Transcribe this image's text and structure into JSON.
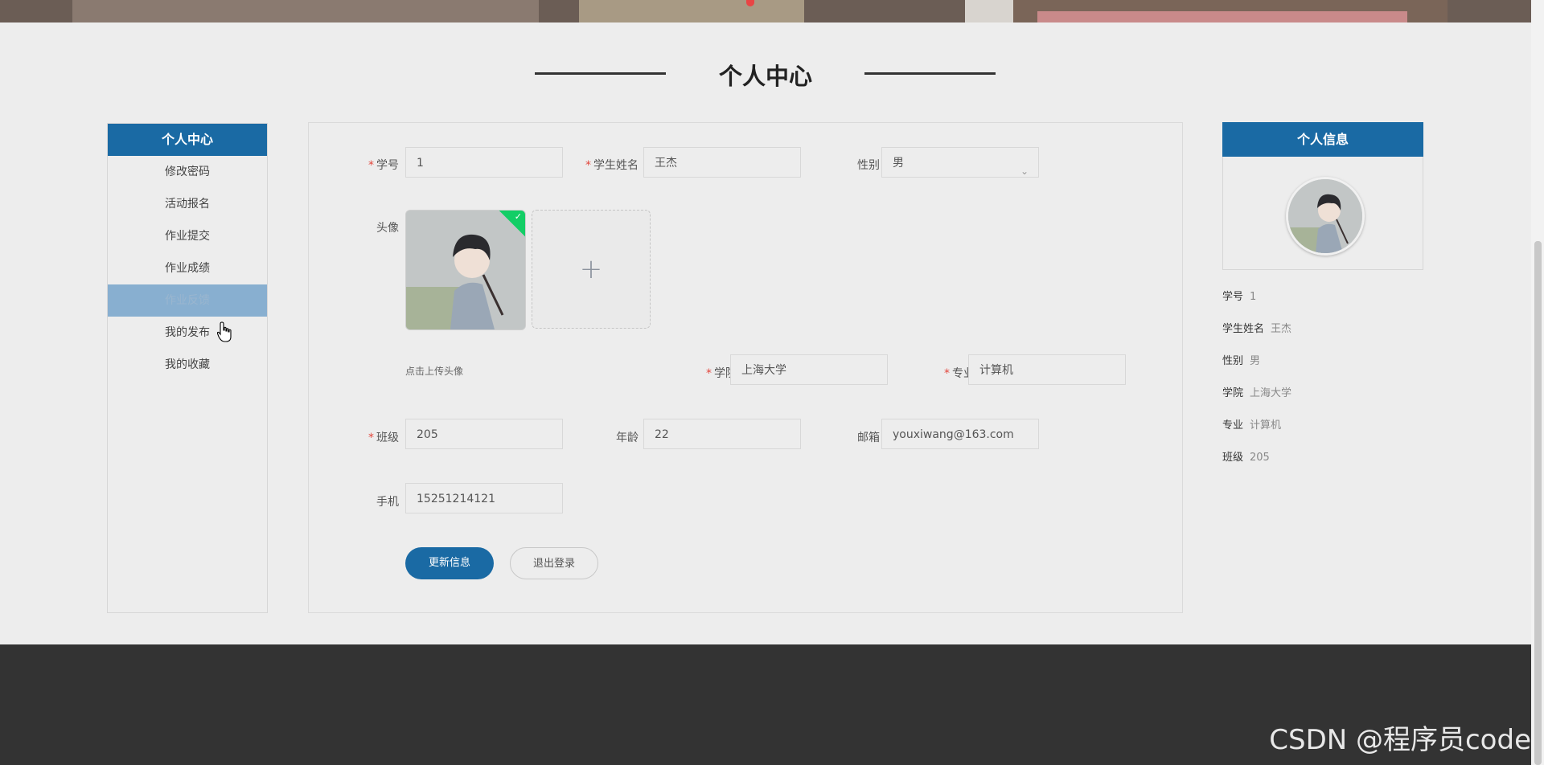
{
  "section_title": "个人中心",
  "sidebar": {
    "title": "个人中心",
    "items": [
      {
        "label": "修改密码"
      },
      {
        "label": "活动报名"
      },
      {
        "label": "作业提交"
      },
      {
        "label": "作业成绩"
      },
      {
        "label": "作业反馈",
        "active": true
      },
      {
        "label": "我的发布"
      },
      {
        "label": "我的收藏"
      }
    ]
  },
  "form": {
    "student_id": {
      "label": "学号",
      "value": "1",
      "required": true
    },
    "student_name": {
      "label": "学生姓名",
      "value": "王杰",
      "required": true
    },
    "gender": {
      "label": "性别",
      "value": "男"
    },
    "avatar": {
      "label": "头像",
      "hint": "点击上传头像"
    },
    "college": {
      "label": "学院",
      "value": "上海大学",
      "required": true
    },
    "major": {
      "label": "专业",
      "value": "计算机",
      "required": true
    },
    "class": {
      "label": "班级",
      "value": "205",
      "required": true
    },
    "age": {
      "label": "年龄",
      "value": "22"
    },
    "email": {
      "label": "邮箱",
      "value": "youxiwang@163.com"
    },
    "phone": {
      "label": "手机",
      "value": "15251214121"
    },
    "update_button": "更新信息",
    "logout_button": "退出登录"
  },
  "info_panel": {
    "title": "个人信息",
    "rows": [
      {
        "label": "学号",
        "value": "1"
      },
      {
        "label": "学生姓名",
        "value": "王杰"
      },
      {
        "label": "性别",
        "value": "男"
      },
      {
        "label": "学院",
        "value": "上海大学"
      },
      {
        "label": "专业",
        "value": "计算机"
      },
      {
        "label": "班级",
        "value": "205"
      }
    ]
  },
  "watermark": "CSDN @程序员code",
  "colors": {
    "primary": "#1a6aa4",
    "active_item": "#88afd0",
    "footer": "#333333",
    "required": "#e2463c"
  }
}
